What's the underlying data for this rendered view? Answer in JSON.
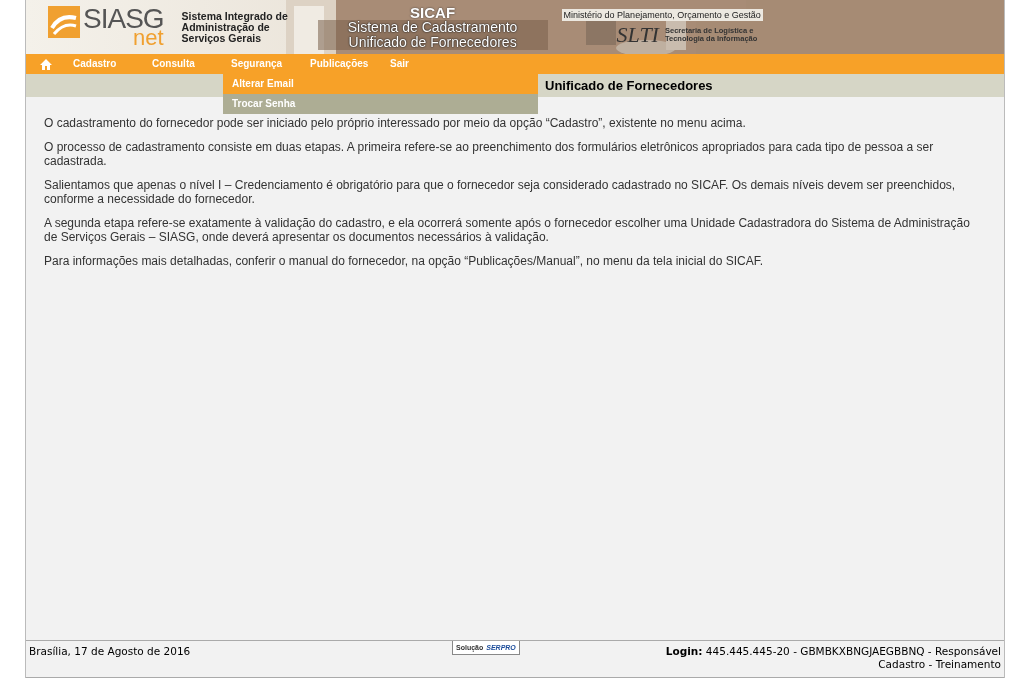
{
  "banner": {
    "logo": "SIASG",
    "logo_sub": "net",
    "system_name": [
      "Sistema Integrado de",
      "Administração de",
      "Serviços Gerais"
    ],
    "app_name": "SICAF",
    "app_title": [
      "Sistema de Cadastramento",
      "Unificado de Fornecedores"
    ],
    "ministry": "Ministério do Planejamento, Orçamento e Gestão",
    "slti": "SLTI",
    "slti_name": [
      "Secretaria de Logística e",
      "Tecnologia da Informação"
    ]
  },
  "menu": [
    {
      "label": "Cadastro"
    },
    {
      "label": "Consulta"
    },
    {
      "label": "Segurança",
      "children": [
        {
          "label": "Alterar Email",
          "selected": false
        },
        {
          "label": "Trocar Senha",
          "selected": true
        }
      ]
    },
    {
      "label": "Publicações"
    },
    {
      "label": "Sair"
    }
  ],
  "page_title": "Unificado de Fornecedores",
  "paragraphs": [
    "O cadastramento do fornecedor pode ser iniciado pelo próprio interessado por meio da opção “Cadastro”, existente no menu acima.",
    "O processo de cadastramento consiste em duas etapas. A primeira refere-se ao preenchimento dos formulários eletrônicos apropriados para cada tipo de pessoa a ser cadastrada.",
    "Salientamos que apenas o nível I – Credenciamento é obrigatório para que o fornecedor seja considerado cadastrado no SICAF. Os demais níveis devem ser preenchidos, conforme a necessidade do fornecedor.",
    "A segunda etapa refere-se exatamente à validação do cadastro, e ela ocorrerá somente após o fornecedor escolher uma Unidade Cadastradora do Sistema de Administração de Serviços Gerais – SIASG, onde deverá apresentar os documentos necessários à validação.",
    "Para informações mais detalhadas, conferir o manual do fornecedor, na opção “Publicações/Manual”, no menu da tela inicial do SICAF."
  ],
  "footer": {
    "date": "Brasília, 17 de Agosto de 2016",
    "badge_label": "Solução",
    "badge_brand": "SERPRO",
    "login_label": "Login:",
    "login_value": "445.445.445-20 - GBMBKXBNGJAEGBBNQ - Responsável Cadastro - Treinamento"
  }
}
